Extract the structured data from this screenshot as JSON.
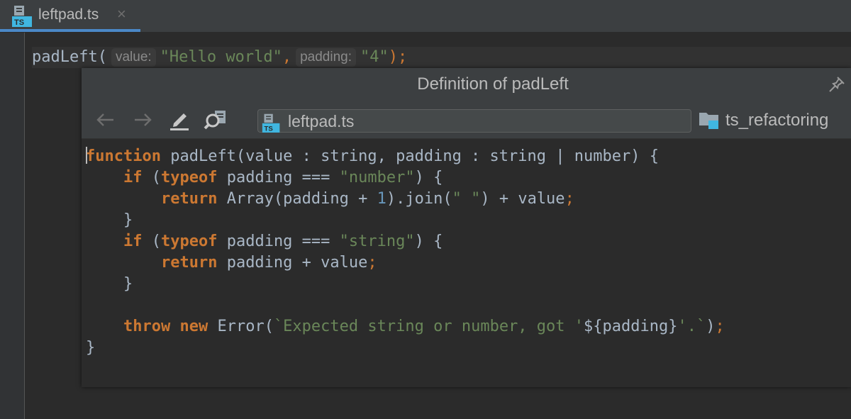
{
  "tab": {
    "icon": "typescript-file-icon",
    "icon_text": "TS",
    "label": "leftpad.ts",
    "close": "×"
  },
  "editor": {
    "call": "padLeft",
    "open_paren": "(",
    "hint_value": "value:",
    "arg1": "\"Hello world\"",
    "comma": ",",
    "hint_padding": "padding:",
    "arg2": "\"4\"",
    "close": ");"
  },
  "popup": {
    "title": "Definition of padLeft",
    "pin_icon": "pin-icon",
    "toolbar": {
      "back_icon": "arrow-left-icon",
      "forward_icon": "arrow-right-icon",
      "edit_icon": "edit-source-icon",
      "find_usages_icon": "find-usages-icon",
      "file_label": "leftpad.ts",
      "module_label": "ts_refactoring"
    },
    "code": [
      [
        {
          "t": "function",
          "c": "kw"
        },
        {
          "t": " padLeft(value : string, padding : string | number) {",
          "c": "ident"
        }
      ],
      [
        {
          "t": "    ",
          "c": "ident"
        },
        {
          "t": "if",
          "c": "kw"
        },
        {
          "t": " (",
          "c": "ident"
        },
        {
          "t": "typeof",
          "c": "kw"
        },
        {
          "t": " padding === ",
          "c": "ident"
        },
        {
          "t": "\"number\"",
          "c": "str"
        },
        {
          "t": ") {",
          "c": "ident"
        }
      ],
      [
        {
          "t": "        ",
          "c": "ident"
        },
        {
          "t": "return",
          "c": "kw"
        },
        {
          "t": " Array(padding + ",
          "c": "ident"
        },
        {
          "t": "1",
          "c": "num"
        },
        {
          "t": ").join(",
          "c": "ident"
        },
        {
          "t": "\" \"",
          "c": "str"
        },
        {
          "t": ") + value",
          "c": "ident"
        },
        {
          "t": ";",
          "c": "op"
        }
      ],
      [
        {
          "t": "    }",
          "c": "ident"
        }
      ],
      [
        {
          "t": "    ",
          "c": "ident"
        },
        {
          "t": "if",
          "c": "kw"
        },
        {
          "t": " (",
          "c": "ident"
        },
        {
          "t": "typeof",
          "c": "kw"
        },
        {
          "t": " padding === ",
          "c": "ident"
        },
        {
          "t": "\"string\"",
          "c": "str"
        },
        {
          "t": ") {",
          "c": "ident"
        }
      ],
      [
        {
          "t": "        ",
          "c": "ident"
        },
        {
          "t": "return",
          "c": "kw"
        },
        {
          "t": " padding + value",
          "c": "ident"
        },
        {
          "t": ";",
          "c": "op"
        }
      ],
      [
        {
          "t": "    }",
          "c": "ident"
        }
      ],
      [
        {
          "t": "",
          "c": "ident"
        }
      ],
      [
        {
          "t": "    ",
          "c": "ident"
        },
        {
          "t": "throw",
          "c": "kw"
        },
        {
          "t": " ",
          "c": "ident"
        },
        {
          "t": "new",
          "c": "kw"
        },
        {
          "t": " Error(",
          "c": "ident"
        },
        {
          "t": "`Expected string or number, got '",
          "c": "str"
        },
        {
          "t": "${padding}",
          "c": "ident"
        },
        {
          "t": "'.`",
          "c": "str"
        },
        {
          "t": ")",
          "c": "ident"
        },
        {
          "t": ";",
          "c": "op"
        }
      ],
      [
        {
          "t": "}",
          "c": "ident"
        }
      ]
    ]
  },
  "colors": {
    "background": "#2b2b2b",
    "panel": "#3c3f41",
    "keyword": "#cc7832",
    "string": "#6a8759",
    "number": "#6897bb",
    "identifier": "#a9b7c6",
    "tab_underline": "#4a88c7"
  }
}
